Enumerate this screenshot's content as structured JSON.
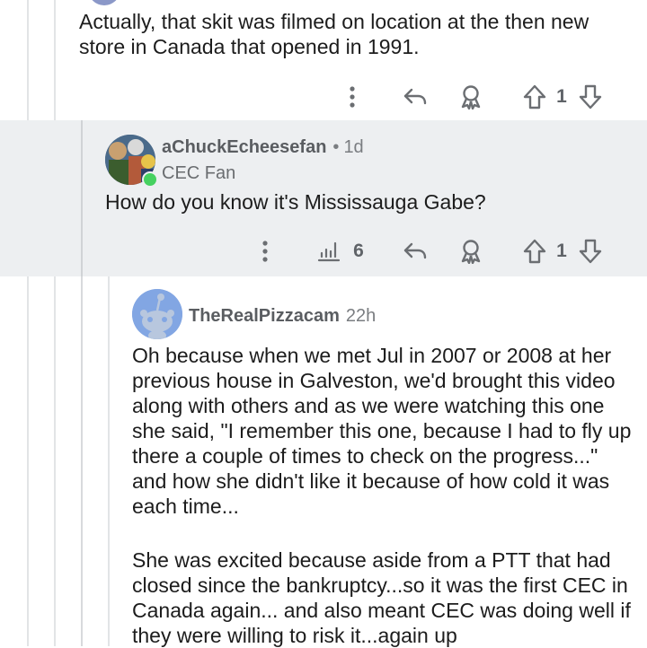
{
  "comment1": {
    "body": "Actually, that skit was filmed on location at the then new store in Canada that opened in 1991.",
    "vote_count": "1"
  },
  "comment2": {
    "username": "aChuckEcheesefan",
    "separator": "•",
    "age": "1d",
    "flair": "CEC Fan",
    "body": "How do you know it's Mississauga Gabe?",
    "views_count": "6",
    "vote_count": "1"
  },
  "comment3": {
    "username": "TheRealPizzacam",
    "age": "22h",
    "paragraph1": "Oh because when we met Jul in 2007 or 2008 at her previous house in Galveston, we'd brought this video along with others and as we were watching this one she said, \"I remember this one, because I had to fly up there a couple of times to check on the progress...\" and how she didn't like it because of how cold it was each time...",
    "paragraph2": "She was excited because aside from a PTT that had closed since the bankruptcy...so it was the first CEC in Canada again... and also meant CEC was doing well if they were willing to risk it...again up"
  },
  "colors": {
    "highlight_bg": "#edeff1",
    "online_dot": "#46d160",
    "icon_gray": "#6b6e72",
    "thread_line": "#e2e4e6"
  },
  "icons": [
    "more-icon",
    "reply-icon",
    "award-icon",
    "upvote-icon",
    "downvote-icon",
    "stats-icon"
  ]
}
